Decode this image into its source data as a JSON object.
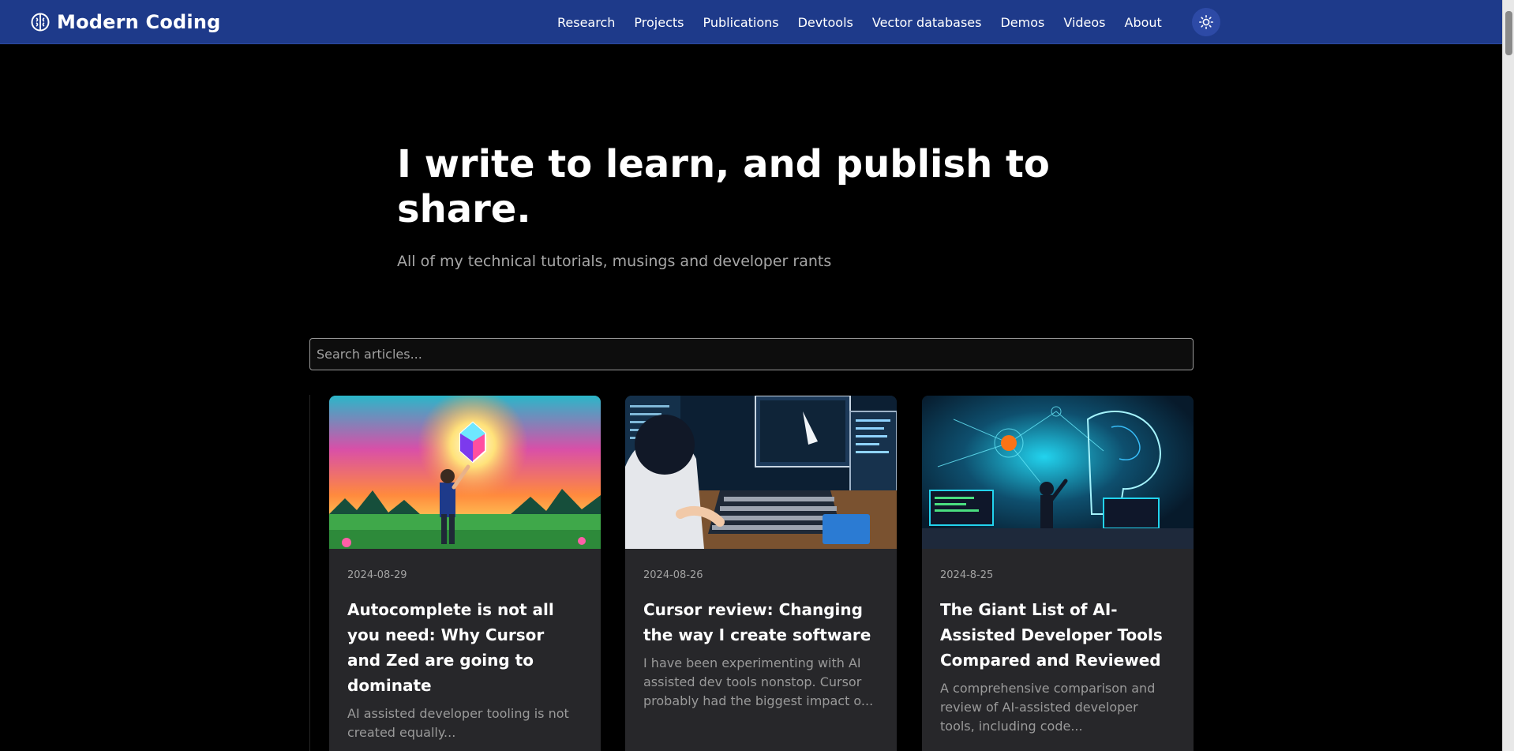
{
  "header": {
    "brand": "Modern Coding",
    "brand_icon": "brain-icon",
    "nav": [
      {
        "label": "Research"
      },
      {
        "label": "Projects"
      },
      {
        "label": "Publications"
      },
      {
        "label": "Devtools"
      },
      {
        "label": "Vector databases"
      },
      {
        "label": "Demos"
      },
      {
        "label": "Videos"
      },
      {
        "label": "About"
      }
    ],
    "theme_toggle_icon": "sun-icon",
    "background": "#1e3a8a"
  },
  "hero": {
    "title": "I write to learn, and publish to share.",
    "subtitle": "All of my technical tutorials, musings and developer rants"
  },
  "search": {
    "placeholder": "Search articles..."
  },
  "articles": [
    {
      "date": "2024-08-29",
      "title": "Autocomplete is not all you need: Why Cursor and Zed are going to dominate",
      "excerpt": "AI assisted developer tooling is not created equally..."
    },
    {
      "date": "2024-08-26",
      "title": "Cursor review: Changing the way I create software",
      "excerpt": "I have been experimenting with AI assisted dev tools nonstop. Cursor probably had the biggest impact o..."
    },
    {
      "date": "2024-8-25",
      "title": "The Giant List of AI-Assisted Developer Tools Compared and Reviewed",
      "excerpt": "A comprehensive comparison and review of AI-assisted developer tools, including code..."
    }
  ]
}
